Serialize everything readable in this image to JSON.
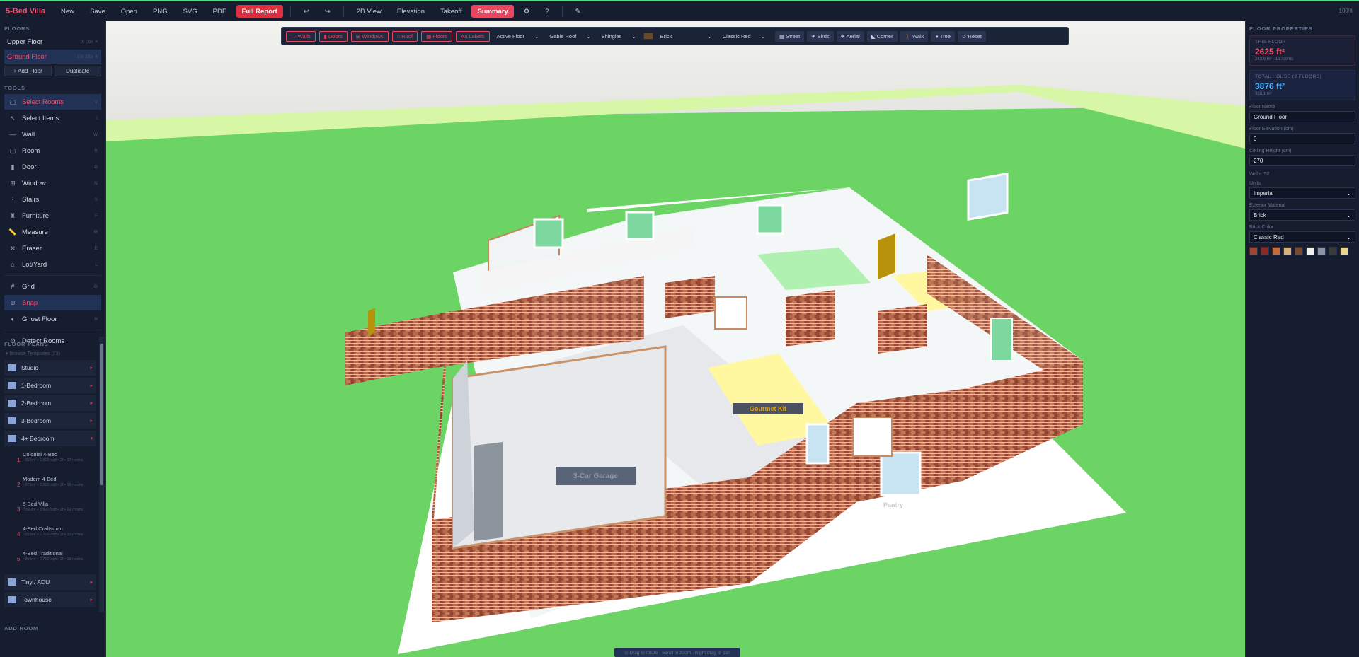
{
  "app": {
    "title": "5-Bed Villa",
    "zoom": "100%"
  },
  "topbar": {
    "new": "New",
    "save": "Save",
    "open": "Open",
    "png": "PNG",
    "svg": "SVG",
    "pdf": "PDF",
    "full_report": "Full Report",
    "undo": "↩",
    "redo": "↪",
    "view_2d": "2D View",
    "elevation": "Elevation",
    "takeoff": "Takeoff",
    "summary": "Summary",
    "settings": "⚙",
    "help": "?",
    "pen": "✎"
  },
  "floors": {
    "label": "FLOORS",
    "items": [
      {
        "name": "Upper Floor",
        "meta": "0r 0bx ✕"
      },
      {
        "name": "Ground Floor",
        "meta": "13r 32w ✕"
      }
    ],
    "add": "+ Add Floor",
    "duplicate": "Duplicate"
  },
  "tools": {
    "label": "TOOLS",
    "items": [
      {
        "name": "Select Rooms",
        "key": "V",
        "icon": "▢"
      },
      {
        "name": "Select Items",
        "key": "I",
        "icon": "↖"
      },
      {
        "name": "Wall",
        "key": "W",
        "icon": "—"
      },
      {
        "name": "Room",
        "key": "R",
        "icon": "▢"
      },
      {
        "name": "Door",
        "key": "D",
        "icon": "▮"
      },
      {
        "name": "Window",
        "key": "N",
        "icon": "⊞"
      },
      {
        "name": "Stairs",
        "key": "S",
        "icon": "⋮"
      },
      {
        "name": "Furniture",
        "key": "F",
        "icon": "♜"
      },
      {
        "name": "Measure",
        "key": "M",
        "icon": "📏"
      },
      {
        "name": "Eraser",
        "key": "E",
        "icon": "✕"
      },
      {
        "name": "Lot/Yard",
        "key": "L",
        "icon": "⌂"
      }
    ],
    "extra": [
      {
        "name": "Grid",
        "key": "G",
        "icon": "#"
      },
      {
        "name": "Snap",
        "key": "",
        "icon": "⊕"
      },
      {
        "name": "Ghost Floor",
        "key": "H",
        "icon": "◐"
      }
    ],
    "detect": {
      "name": "Detect Rooms",
      "icon": "⚙"
    }
  },
  "floor_plans": {
    "label": "FLOOR PLANS",
    "browse": "▾ Browse Templates (33)",
    "categories_top": [
      {
        "name": "Studio",
        "meta": "5"
      },
      {
        "name": "1-Bedroom",
        "meta": "5"
      },
      {
        "name": "2-Bedroom",
        "meta": "5"
      },
      {
        "name": "3-Bedroom",
        "meta": "5"
      },
      {
        "name": "4+ Bedroom",
        "meta": "5"
      }
    ],
    "templates": [
      {
        "num": "1",
        "name": "Colonial 4-Bed",
        "meta": "~260m² • 2,800 sqft • 2f • 17 rooms"
      },
      {
        "num": "2",
        "name": "Modern 4-Bed",
        "meta": "~270m² • 2,900 sqft • 2f • 16 rooms"
      },
      {
        "num": "3",
        "name": "5-Bed Villa",
        "meta": "~360m² • 3,900 sqft • 2f • 22 rooms"
      },
      {
        "num": "4",
        "name": "4-Bed Craftsman",
        "meta": "~250m² • 2,700 sqft • 2f • 17 rooms"
      },
      {
        "num": "5",
        "name": "4-Bed Traditional",
        "meta": "~255m² • 2,750 sqft • 2f • 18 rooms"
      }
    ],
    "categories_bottom": [
      {
        "name": "Tiny / ADU",
        "meta": "5"
      },
      {
        "name": "Townhouse",
        "meta": "5"
      }
    ]
  },
  "add_room": "ADD ROOM",
  "toolbar3d": {
    "toggles": [
      "— Walls",
      "▮ Doors",
      "⊞ Windows",
      "⌂ Roof",
      "▦ Floors",
      "Aa Labels"
    ],
    "dropdowns": {
      "floor": "Active Floor",
      "roof": "Gable Roof",
      "roofing": "Shingles",
      "material": "Brick",
      "color": "Classic Red"
    },
    "views": [
      "▦ Street",
      "✈ Birds",
      "✈ Aerial",
      "◣ Corner",
      "🚶 Walk",
      "● Tree",
      "↺ Reset"
    ]
  },
  "scene": {
    "label_garage": "3-Car Garage",
    "label_kitchen": "Gourmet Kit",
    "label_pantry": "Pantry"
  },
  "hint": "⊙ Drag to rotate · Scroll to zoom · Right drag to pan",
  "properties": {
    "title": "FLOOR PROPERTIES",
    "this_floor": {
      "label": "THIS FLOOR",
      "value": "2625 ft²",
      "sub": "243.9 m² · 13 rooms"
    },
    "total": {
      "label": "TOTAL HOUSE (2 FLOORS)",
      "value": "3876 ft²",
      "sub": "360.1 m²"
    },
    "floor_name_label": "Floor Name",
    "floor_name": "Ground Floor",
    "elevation_label": "Floor Elevation (cm)",
    "elevation": "0",
    "ceiling_label": "Ceiling Height (cm)",
    "ceiling": "270",
    "walls": "Walls: 52",
    "units_label": "Units",
    "units": "Imperial",
    "ext_label": "Exterior Material",
    "ext": "Brick",
    "brick_label": "Brick Color",
    "brick": "Classic Red",
    "swatches": [
      "#a0442e",
      "#8a2a22",
      "#c66a38",
      "#d8b07a",
      "#7a4a30",
      "#f0f0ec",
      "#8a94a4",
      "#3a3a3a",
      "#e8d48a"
    ]
  }
}
